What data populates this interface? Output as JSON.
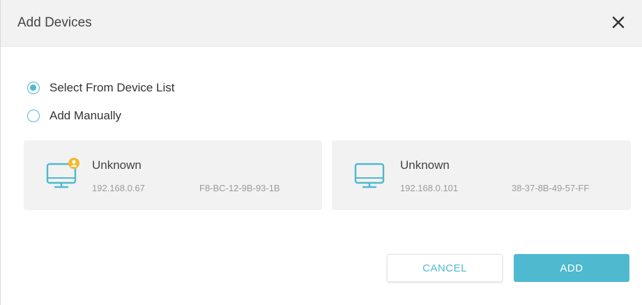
{
  "dialog": {
    "title": "Add Devices",
    "close_icon": "close-icon"
  },
  "options": [
    {
      "label": "Select From Device List",
      "checked": true
    },
    {
      "label": "Add Manually",
      "checked": false
    }
  ],
  "devices": [
    {
      "name": "Unknown",
      "ip": "192.168.0.67",
      "mac": "F8-BC-12-9B-93-1B",
      "icon": "monitor-icon",
      "badge": "user-badge-icon"
    },
    {
      "name": "Unknown",
      "ip": "192.168.0.101",
      "mac": "38-37-8B-49-57-FF",
      "icon": "monitor-icon"
    }
  ],
  "buttons": {
    "cancel_label": "CANCEL",
    "add_label": "ADD"
  },
  "colors": {
    "accent": "#4fb9cf",
    "badge": "#f5b82e",
    "header_bg": "#f2f2f2",
    "card_bg": "#f2f2f2"
  }
}
